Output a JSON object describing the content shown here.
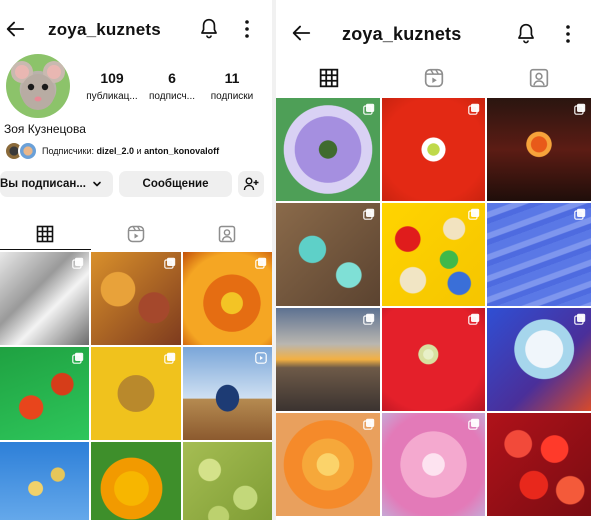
{
  "left": {
    "username": "zoya_kuznets",
    "stats": [
      {
        "num": "109",
        "label": "публикац..."
      },
      {
        "num": "6",
        "label": "подписч..."
      },
      {
        "num": "11",
        "label": "подписки"
      }
    ],
    "real_name": "Зоя Кузнецова",
    "followers_prefix": "Подписчики: ",
    "followers_names": "dizel_2.0",
    "followers_and": " и ",
    "followers_names2": "anton_konovaloff",
    "btn_subscribed": "Вы подписан...",
    "btn_message": "Сообщение",
    "tiles": [
      {
        "name": "frosty-branches",
        "bg": "linear-gradient(135deg,#e8e8e8 0%,#9a9a9a 40%,#f3f3f3 60%,#6b6b6b 100%)",
        "mark": "multi"
      },
      {
        "name": "autumn-still-life",
        "bg": "radial-gradient(circle at 30% 40%,#e8a23a 0 20%,transparent 21%),radial-gradient(circle at 70% 60%,#a5482c 0 18%,transparent 19%),linear-gradient(135deg,#d9902b,#7e3b1e)",
        "mark": "multi"
      },
      {
        "name": "orange-dahlias",
        "bg": "radial-gradient(circle at 55% 55%,#f3c425 0 15%,#e56d12 16% 40%,#f5a623 41% 70%,#c24f0a 100%)",
        "mark": "multi"
      },
      {
        "name": "physalis-on-green",
        "bg": "radial-gradient(circle at 35% 65%,#e8451c 0 14%,transparent 15%),radial-gradient(circle at 70% 40%,#d63d19 0 13%,transparent 14%),linear-gradient(160deg,#1fa141,#2ec65b)",
        "mark": "multi"
      },
      {
        "name": "yellow-leaf",
        "bg": "radial-gradient(circle at 50% 50%,#b9892c 0 28%,#f0c21d 29% 100%)",
        "mark": "multi"
      },
      {
        "name": "church-domes",
        "bg": "radial-gradient(ellipse at 50% 55%,#1d3b74 0 18%,transparent 19%),linear-gradient(180deg,#7aa6d9 0%,#cfe0f2 55%,#b58a50 56%,#8c5a2f 100%)",
        "mark": "reel"
      },
      {
        "name": "blossom-branch",
        "bg": "radial-gradient(circle at 40% 50%,#f1d16a 0 10%,transparent 11%),radial-gradient(circle at 65% 35%,#e6c65a 0 8%,transparent 9%),linear-gradient(180deg,#2d7fd8,#6fb0ee)",
        "mark": "none"
      },
      {
        "name": "yellow-chrysanthemums",
        "bg": "radial-gradient(circle at 45% 50%,#f7b600 0 25%,#f29a00 26% 45%,#3e8f2b 46% 100%)",
        "mark": "none"
      },
      {
        "name": "green-grapes",
        "bg": "radial-gradient(circle at 30% 30%,#d4e28a 0 12%,transparent 13%),radial-gradient(circle at 70% 60%,#c3d87a 0 14%,transparent 15%),radial-gradient(circle at 40% 80%,#bcd16e 0 11%,transparent 12%),linear-gradient(135deg,#a5bd53,#7c9a32)",
        "mark": "none"
      }
    ]
  },
  "right": {
    "username": "zoya_kuznets",
    "tiles": [
      {
        "name": "chafer-beetle-on-flower",
        "bg": "radial-gradient(circle at 50% 50%,#3f6b2e 0 12%,#a58fe0 13% 45%,#d9d1f4 46% 60%,#4e9f57 61% 100%)",
        "mark": "multi"
      },
      {
        "name": "red-poppy",
        "bg": "radial-gradient(circle at 50% 50%,#bfd94a 0 8%,#ffffff 9% 16%,#e32914 17% 70%,#c8230f 100%)",
        "mark": "multi"
      },
      {
        "name": "chinese-lanterns",
        "bg": "radial-gradient(circle at 50% 45%,#e85a1a 0 10%,#f6a33b 11% 16%,transparent 17%),linear-gradient(180deg,#2a1510,#5c1c14 50%,#1f0e0a)",
        "mark": "multi"
      },
      {
        "name": "turquoise-mineral",
        "bg": "radial-gradient(circle at 35% 45%,#5ed0c8 0 15%,transparent 16%),radial-gradient(circle at 70% 70%,#7fe0d6 0 12%,transparent 13%),linear-gradient(135deg,#8a6a4a,#5b4330)",
        "mark": "multi"
      },
      {
        "name": "dice-on-yellow",
        "bg": "radial-gradient(circle at 25% 35%,#e01c1c 0 12%,transparent 13%),radial-gradient(circle at 70% 25%,#f2e3c0 0 10%,transparent 11%),radial-gradient(circle at 65% 55%,#3fb94a 0 10%,transparent 11%),radial-gradient(circle at 30% 75%,#f1e5c4 0 12%,transparent 13%),radial-gradient(circle at 75% 78%,#3a6fd8 0 10%,transparent 11%),linear-gradient(135deg,#ffd400,#f5c500)",
        "mark": "multi"
      },
      {
        "name": "blue-ripples",
        "bg": "repeating-linear-gradient(160deg,#5a78e6 0 8px,#7e96ee 9px 14px,#4e6be0 15px 20px)",
        "mark": "multi"
      },
      {
        "name": "sunset-on-shore",
        "bg": "linear-gradient(180deg,#5d7191 0%,#b9b6b0 35%,#f3b042 50%,#6e5a48 58%,#3b3330 100%)",
        "mark": "multi"
      },
      {
        "name": "red-poppy-close",
        "bg": "radial-gradient(circle at 45% 45%,#e8f0c8 0 6%,#d8e0a0 7% 12%,#e4202a 13% 70%,#b31421 100%)",
        "mark": "multi"
      },
      {
        "name": "white-iris-on-blue",
        "bg": "radial-gradient(circle at 55% 40%,#f0f6fb 0 22%,#a6d6ec 23% 35%,transparent 36%),linear-gradient(135deg,#2f4fd4,#4a2f9a 60%,#d84a2a 100%)",
        "mark": "multi"
      },
      {
        "name": "orange-rose",
        "bg": "radial-gradient(circle at 50% 50%,#fbd36a 0 15%,#f6a83a 16% 35%,#f58a2a 36% 60%,#e9a05d 61% 100%)",
        "mark": "multi"
      },
      {
        "name": "pink-iris",
        "bg": "radial-gradient(circle at 50% 50%,#fde3f0 0 15%,#f4a9cf 16% 45%,#e37ab8 46% 70%,#c6a8d6 100%)",
        "mark": "multi"
      },
      {
        "name": "red-berries",
        "bg": "radial-gradient(circle at 30% 30%,#f24a3a 0 13%,transparent 14%),radial-gradient(circle at 65% 35%,#ff3a2a 0 14%,transparent 15%),radial-gradient(circle at 45% 70%,#e8281c 0 15%,transparent 16%),radial-gradient(circle at 80% 75%,#f45a3a 0 12%,transparent 13%),linear-gradient(135deg,#b0121a,#7a0c12)",
        "mark": "none"
      }
    ]
  },
  "icons": {
    "back": "arrow-left-icon",
    "bell": "bell-icon",
    "more": "more-vertical-icon",
    "grid": "grid-icon",
    "reels": "reels-icon",
    "tagged": "tagged-icon",
    "add_person": "add-person-icon",
    "chevron": "chevron-down-icon"
  },
  "colors": {
    "text": "#111111",
    "button_bg": "#efefef",
    "icon_inactive": "#8e8e8e"
  }
}
